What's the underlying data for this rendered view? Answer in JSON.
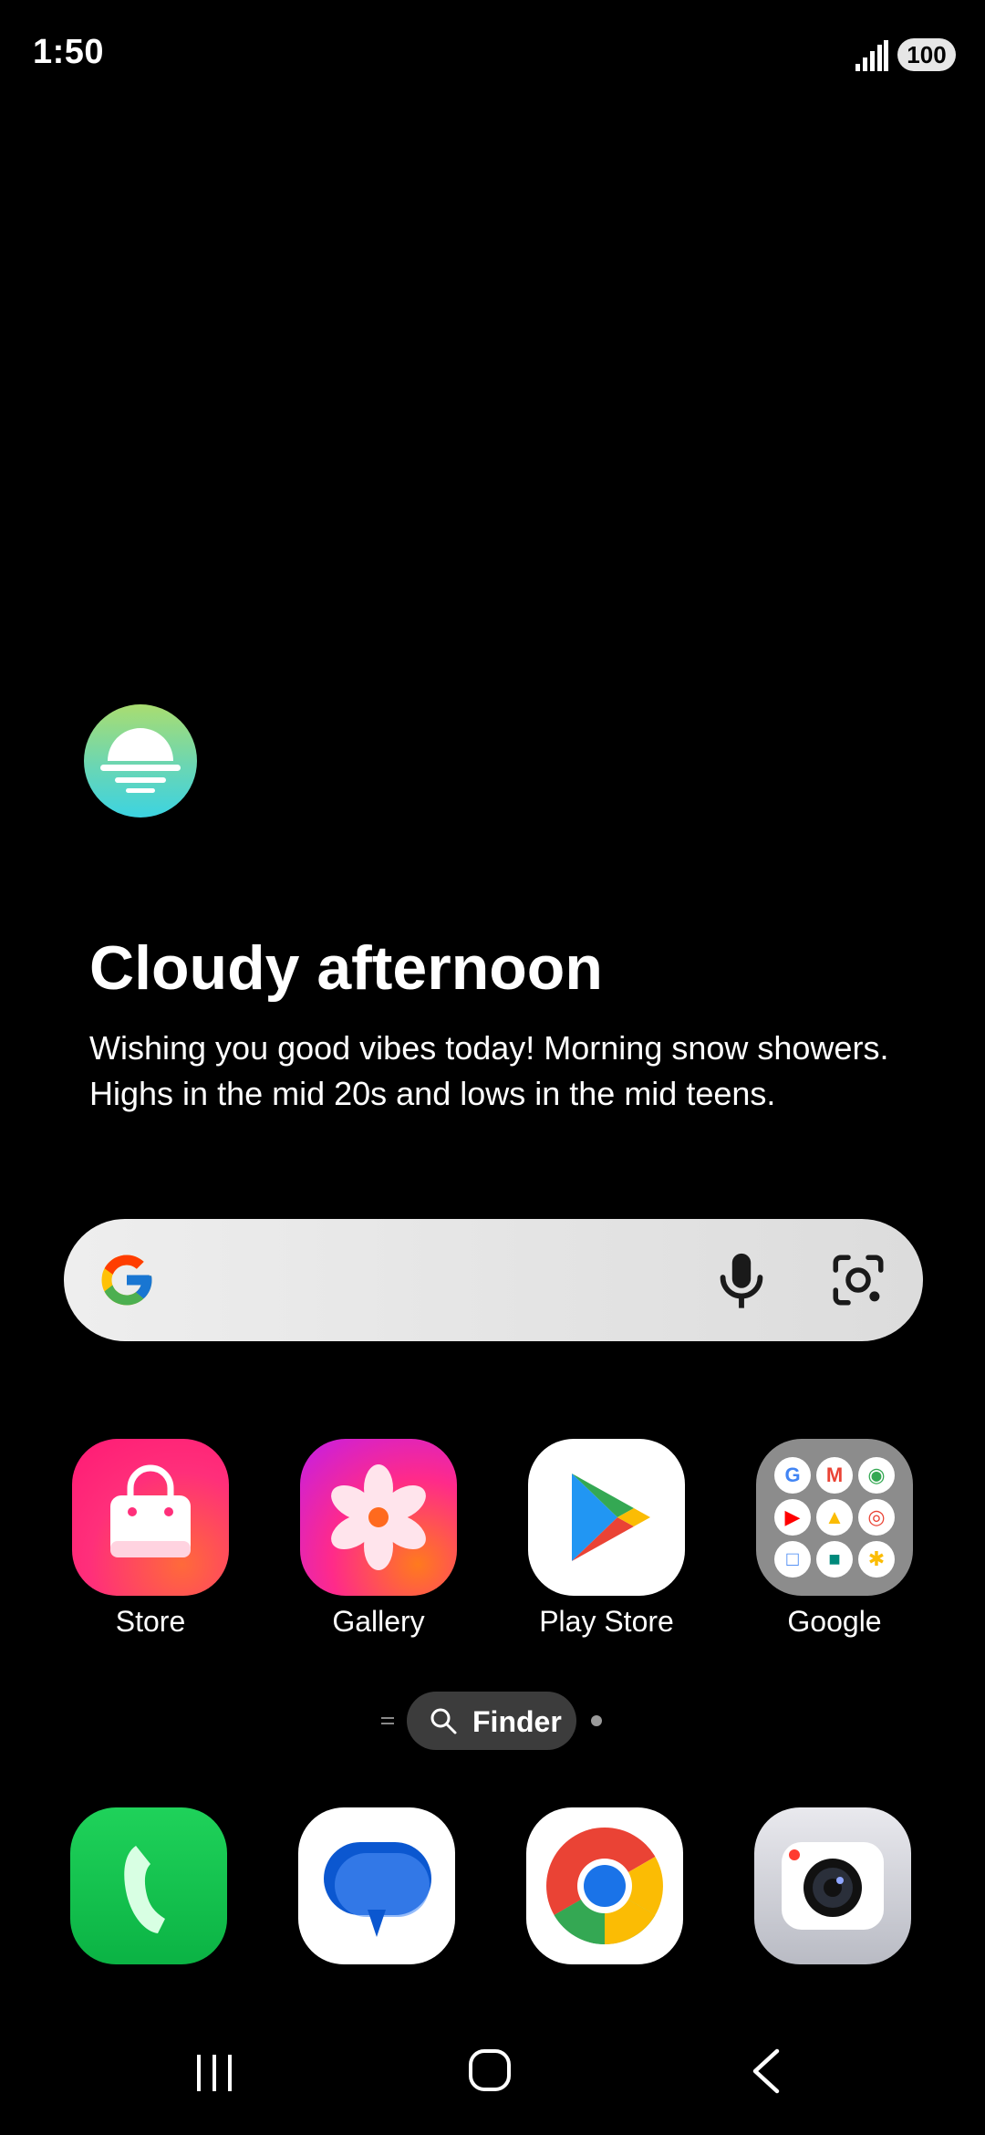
{
  "status_bar": {
    "time": "1:50",
    "battery": "100",
    "signal_icon": "signal-bars-icon"
  },
  "weather": {
    "icon": "sun-haze-icon",
    "title": "Cloudy afternoon",
    "description": "Wishing you good vibes today! Morning snow showers. Highs in the mid 20s and lows in the mid teens."
  },
  "search": {
    "icons": [
      "google-g-icon",
      "microphone-icon",
      "lens-camera-icon"
    ]
  },
  "apps": [
    {
      "label": "Store",
      "icon": "store-bag-icon"
    },
    {
      "label": "Gallery",
      "icon": "gallery-flower-icon"
    },
    {
      "label": "Play Store",
      "icon": "play-store-icon"
    },
    {
      "label": "Google",
      "icon": "google-folder-icon"
    }
  ],
  "finder": {
    "label": "Finder"
  },
  "dock": [
    {
      "name": "phone",
      "icon": "phone-icon"
    },
    {
      "name": "messages",
      "icon": "messages-icon"
    },
    {
      "name": "chrome",
      "icon": "chrome-icon"
    },
    {
      "name": "camera",
      "icon": "camera-icon"
    }
  ],
  "nav": {
    "icons": [
      "recents-icon",
      "home-icon",
      "back-icon"
    ]
  },
  "colors": {
    "background": "#000000",
    "search_bar": "#e4e4e4",
    "finder_pill": "#3c3c3c"
  }
}
